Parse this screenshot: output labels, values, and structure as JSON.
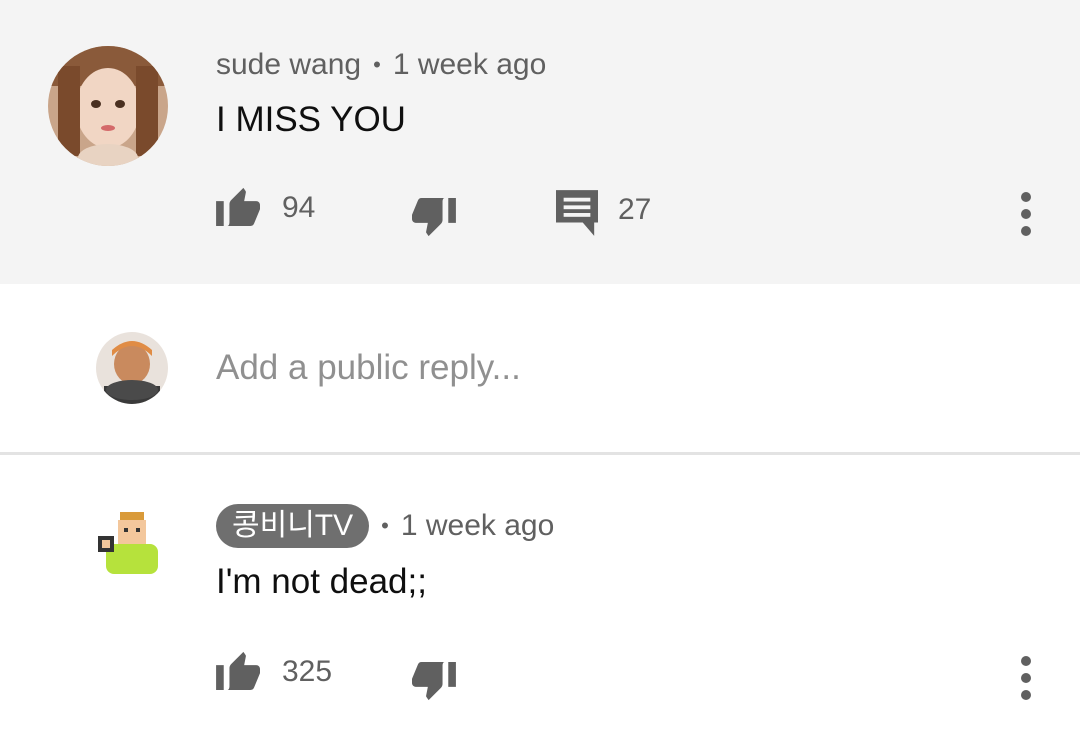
{
  "comments": [
    {
      "author": "sude wang",
      "separator": "•",
      "time": "1 week ago",
      "text": "I MISS YOU",
      "likes": "94",
      "replies": "27"
    },
    {
      "author": "콩비니TV",
      "separator": "•",
      "time": "1 week ago",
      "text": "I'm not dead;;",
      "likes": "325"
    }
  ],
  "reply_box": {
    "placeholder": "Add a public reply..."
  },
  "icons": {
    "like": "thumbs-up-icon",
    "dislike": "thumbs-down-icon",
    "reply": "comment-icon",
    "more": "more-vertical-icon"
  },
  "colors": {
    "highlight_bg": "#f4f4f4",
    "icon_gray": "#606060",
    "author_chip_bg": "#6f6f6f"
  }
}
